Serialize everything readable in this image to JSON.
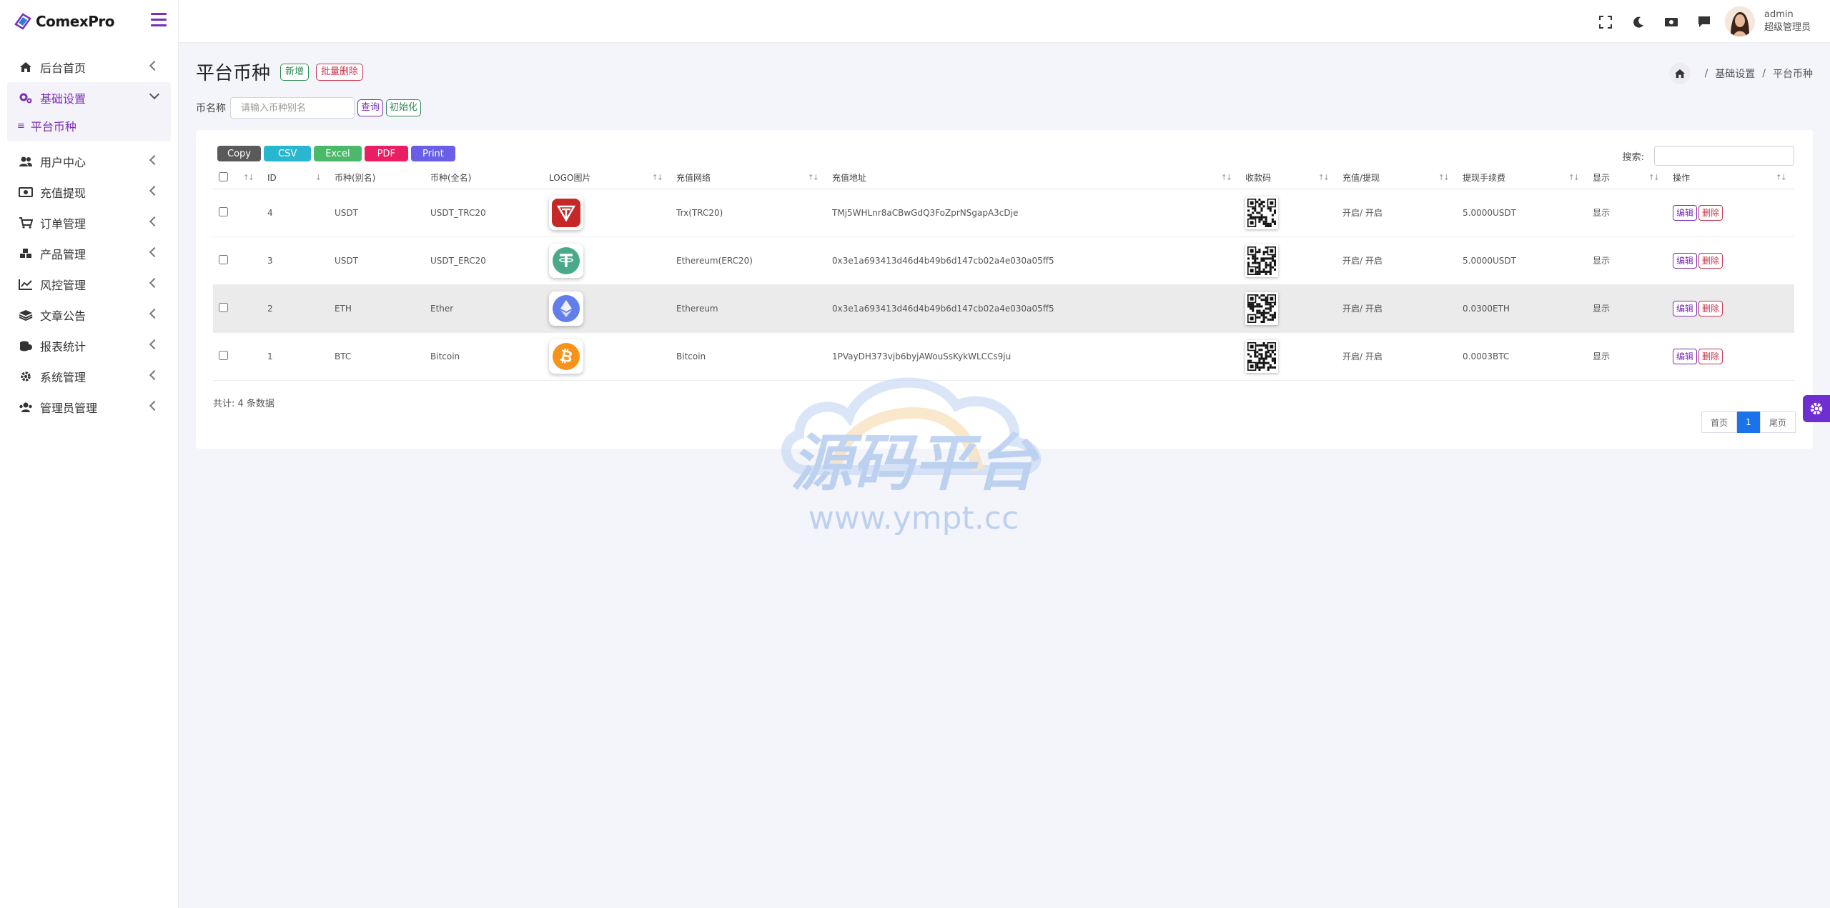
{
  "brand": {
    "name": "ComexPro"
  },
  "sidebar": {
    "items": [
      {
        "label": "后台首页"
      },
      {
        "label": "基础设置"
      },
      {
        "label": "用户中心"
      },
      {
        "label": "充值提现"
      },
      {
        "label": "订单管理"
      },
      {
        "label": "产品管理"
      },
      {
        "label": "风控管理"
      },
      {
        "label": "文章公告"
      },
      {
        "label": "报表统计"
      },
      {
        "label": "系统管理"
      },
      {
        "label": "管理员管理"
      }
    ],
    "submenu": [
      {
        "label": "平台币种"
      }
    ]
  },
  "user": {
    "name": "admin",
    "role": "超级管理员"
  },
  "page": {
    "title": "平台币种",
    "add_label": "新增",
    "batch_delete_label": "批量删除"
  },
  "breadcrumb": {
    "level1": "基础设置",
    "current": "平台币种"
  },
  "filter": {
    "label": "币名称",
    "placeholder": "请输入币种别名",
    "query_label": "查询",
    "init_label": "初始化"
  },
  "export": {
    "copy": "Copy",
    "csv": "CSV",
    "excel": "Excel",
    "pdf": "PDF",
    "print": "Print"
  },
  "search": {
    "label": "搜索:"
  },
  "table": {
    "headers": [
      "ID",
      "币种(别名)",
      "币种(全名)",
      "LOGO图片",
      "充值网络",
      "充值地址",
      "收款码",
      "充值/提现",
      "提现手续费",
      "显示",
      "操作"
    ],
    "rows": [
      {
        "id": "4",
        "alias": "USDT",
        "fullname": "USDT_TRC20",
        "network": "Trx(TRC20)",
        "address": "TMj5WHLnr8aCBwGdQ3FoZprNSgapA3cDje",
        "status": "开启/ 开启",
        "fee": "5.0000USDT",
        "show": "显示",
        "edit": "编辑",
        "delete": "删除"
      },
      {
        "id": "3",
        "alias": "USDT",
        "fullname": "USDT_ERC20",
        "network": "Ethereum(ERC20)",
        "address": "0x3e1a693413d46d4b49b6d147cb02a4e030a05ff5",
        "status": "开启/ 开启",
        "fee": "5.0000USDT",
        "show": "显示",
        "edit": "编辑",
        "delete": "删除"
      },
      {
        "id": "2",
        "alias": "ETH",
        "fullname": "Ether",
        "network": "Ethereum",
        "address": "0x3e1a693413d46d4b49b6d147cb02a4e030a05ff5",
        "status": "开启/ 开启",
        "fee": "0.0300ETH",
        "show": "显示",
        "edit": "编辑",
        "delete": "删除"
      },
      {
        "id": "1",
        "alias": "BTC",
        "fullname": "Bitcoin",
        "network": "Bitcoin",
        "address": "1PVayDH373vjb6byjAWouSsKykWLCCs9ju",
        "status": "开启/ 开启",
        "fee": "0.0003BTC",
        "show": "显示",
        "edit": "编辑",
        "delete": "删除"
      }
    ]
  },
  "footer": {
    "total": "共计: 4 条数据"
  },
  "pager": {
    "first": "首页",
    "current": "1",
    "last": "尾页"
  },
  "watermark": {
    "text": "源码平台",
    "url": "www.ympt.cc"
  },
  "colors": {
    "accent": "#7a2fb5",
    "copy": "#5a5a5a",
    "csv": "#29b6cf",
    "excel": "#4cb869",
    "pdf": "#e91e63",
    "print": "#6a5de6",
    "tron": "#c62828",
    "tether": "#4aa88b",
    "eth": "#627eea",
    "btc": "#f7931a"
  }
}
